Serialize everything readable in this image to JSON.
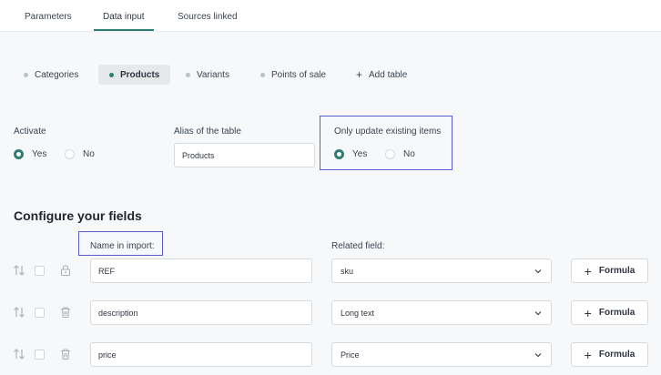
{
  "top_tabs": [
    {
      "label": "Parameters",
      "active": false
    },
    {
      "label": "Data input",
      "active": true
    },
    {
      "label": "Sources linked",
      "active": false
    }
  ],
  "table_tabs": [
    {
      "label": "Categories",
      "active": false
    },
    {
      "label": "Products",
      "active": true
    },
    {
      "label": "Variants",
      "active": false
    },
    {
      "label": "Points of sale",
      "active": false
    }
  ],
  "add_table_label": "Add table",
  "activate": {
    "label": "Activate",
    "yes": "Yes",
    "no": "No",
    "selected": "Yes"
  },
  "alias": {
    "label": "Alias of the table",
    "value": "Products"
  },
  "only_update": {
    "label": "Only update existing items",
    "yes": "Yes",
    "no": "No",
    "selected": "Yes"
  },
  "configure_title": "Configure your fields",
  "columns": {
    "name_in_import": "Name in import:",
    "related_field": "Related field:"
  },
  "rows": [
    {
      "name": "REF",
      "related": "sku",
      "formula": "Formula",
      "icon": "lock-icon"
    },
    {
      "name": "description",
      "related": "Long text",
      "formula": "Formula",
      "icon": "trash-icon"
    },
    {
      "name": "price",
      "related": "Price",
      "formula": "Formula",
      "icon": "trash-icon"
    }
  ],
  "colors": {
    "accent": "#2f7d73",
    "highlight": "#5b5bd6"
  }
}
